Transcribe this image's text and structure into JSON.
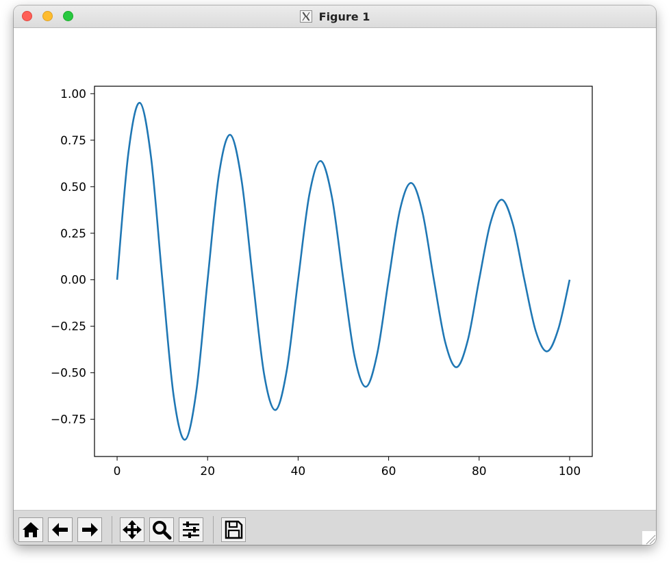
{
  "window": {
    "title": "Figure 1",
    "app_icon": "x11-icon"
  },
  "toolbar": {
    "buttons": [
      {
        "name": "home-button",
        "icon": "home-icon"
      },
      {
        "name": "back-button",
        "icon": "arrow-left-icon"
      },
      {
        "name": "forward-button",
        "icon": "arrow-right-icon"
      },
      {
        "name": "pan-button",
        "icon": "move-icon"
      },
      {
        "name": "zoom-button",
        "icon": "magnifier-icon"
      },
      {
        "name": "configure-subplots-button",
        "icon": "sliders-icon"
      },
      {
        "name": "save-button",
        "icon": "floppy-disk-icon"
      }
    ]
  },
  "colors": {
    "line": "#1f77b4",
    "axes": "#000000",
    "titlebar": "#e3e3e3",
    "toolbar": "#d9d9d9"
  },
  "chart_data": {
    "type": "line",
    "title": "",
    "xlabel": "",
    "ylabel": "",
    "xlim": [
      -5,
      105
    ],
    "ylim": [
      -0.95,
      1.04
    ],
    "grid": false,
    "xticks": [
      0,
      20,
      40,
      60,
      80,
      100
    ],
    "xtick_labels": [
      "0",
      "20",
      "40",
      "60",
      "80",
      "100"
    ],
    "yticks": [
      -0.75,
      -0.5,
      -0.25,
      0.0,
      0.25,
      0.5,
      0.75,
      1.0
    ],
    "ytick_labels": [
      "−0.75",
      "−0.50",
      "−0.25",
      "0.00",
      "0.25",
      "0.50",
      "0.75",
      "1.00"
    ],
    "series": [
      {
        "x": [
          0,
          2.5,
          5,
          7.5,
          10,
          12.5,
          15,
          17.5,
          20,
          22.5,
          25,
          27.5,
          30,
          32.5,
          35,
          37.5,
          40,
          42.5,
          45,
          47.5,
          50,
          52.5,
          55,
          57.5,
          60,
          62.5,
          65,
          67.5,
          70,
          72.5,
          75,
          77.5,
          80,
          82.5,
          85,
          87.5,
          90,
          92.5,
          95,
          97.5,
          100
        ],
        "y": [
          0.0,
          0.683,
          0.951,
          0.658,
          0.0,
          -0.625,
          -0.86,
          -0.6,
          0.0,
          0.565,
          0.779,
          0.535,
          0.0,
          -0.51,
          -0.7,
          -0.485,
          0.0,
          0.46,
          0.638,
          0.44,
          0.0,
          -0.415,
          -0.575,
          -0.395,
          0.0,
          0.375,
          0.52,
          0.36,
          0.0,
          -0.335,
          -0.47,
          -0.325,
          0.0,
          0.305,
          0.43,
          0.295,
          0.0,
          -0.275,
          -0.385,
          -0.265,
          0.0
        ]
      }
    ]
  }
}
